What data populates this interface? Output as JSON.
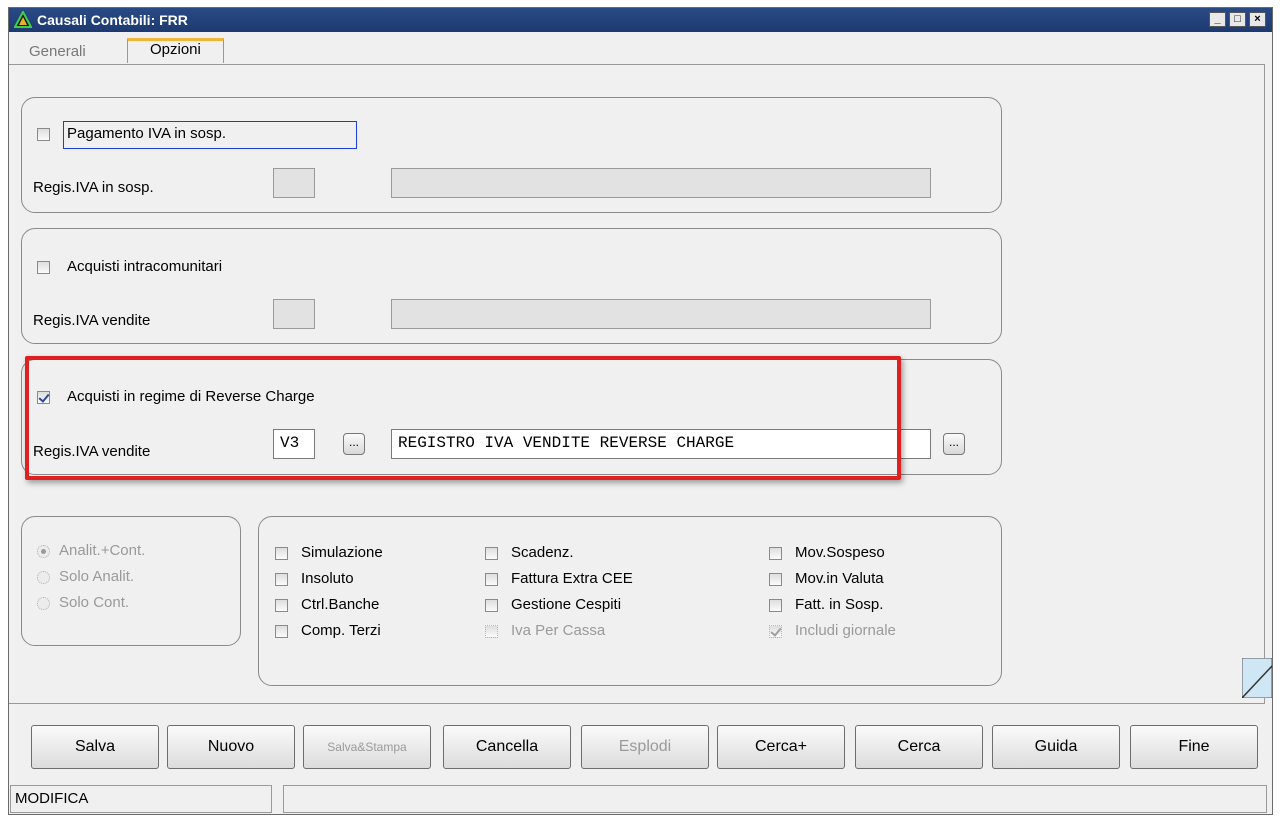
{
  "window": {
    "title": "Causali Contabili: FRR",
    "controls": [
      "_",
      "□",
      "×"
    ]
  },
  "tabs": [
    {
      "label": "Generali",
      "active": false
    },
    {
      "label": "Opzioni",
      "active": true
    }
  ],
  "group_pagamento": {
    "checkbox_label": "Pagamento IVA in sosp.",
    "checked": false,
    "field_label": "Regis.IVA in sosp.",
    "code_value": "",
    "desc_value": ""
  },
  "group_intra": {
    "checkbox_label": "Acquisti intracomunitari",
    "checked": false,
    "field_label": "Regis.IVA vendite",
    "code_value": "",
    "desc_value": ""
  },
  "group_reverse": {
    "checkbox_label": "Acquisti in regime di Reverse Charge",
    "checked": true,
    "field_label": "Regis.IVA vendite",
    "code_value": "V3",
    "desc_value": "REGISTRO IVA VENDITE REVERSE CHARGE",
    "lookup_label": "..."
  },
  "radio_group": {
    "options": [
      {
        "label": "Analit.+Cont.",
        "selected": true
      },
      {
        "label": "Solo Analit.",
        "selected": false
      },
      {
        "label": "Solo Cont.",
        "selected": false
      }
    ]
  },
  "options_checkboxes": {
    "col1": [
      {
        "label": "Simulazione",
        "checked": false,
        "enabled": true
      },
      {
        "label": "Insoluto",
        "checked": false,
        "enabled": true
      },
      {
        "label": "Ctrl.Banche",
        "checked": false,
        "enabled": true
      },
      {
        "label": "Comp. Terzi",
        "checked": false,
        "enabled": true
      }
    ],
    "col2": [
      {
        "label": "Scadenz.",
        "checked": false,
        "enabled": true
      },
      {
        "label": "Fattura Extra CEE",
        "checked": false,
        "enabled": true
      },
      {
        "label": "Gestione Cespiti",
        "checked": false,
        "enabled": true
      },
      {
        "label": "Iva Per Cassa",
        "checked": false,
        "enabled": false
      }
    ],
    "col3": [
      {
        "label": "Mov.Sospeso",
        "checked": false,
        "enabled": true
      },
      {
        "label": "Mov.in Valuta",
        "checked": false,
        "enabled": true
      },
      {
        "label": "Fatt. in Sosp.",
        "checked": false,
        "enabled": true
      },
      {
        "label": "Includi giornale",
        "checked": true,
        "enabled": false
      }
    ]
  },
  "buttons": {
    "salva": "Salva",
    "nuovo": "Nuovo",
    "salva_stampa": "Salva&Stampa",
    "cancella": "Cancella",
    "esplodi": "Esplodi",
    "cerca_plus": "Cerca+",
    "cerca": "Cerca",
    "guida": "Guida",
    "fine": "Fine"
  },
  "status": {
    "mode": "MODIFICA",
    "message": ""
  },
  "colors": {
    "titlebar": "#1d3a70",
    "highlight_box": "#e02020",
    "tab_accent": "#f3b43a"
  }
}
